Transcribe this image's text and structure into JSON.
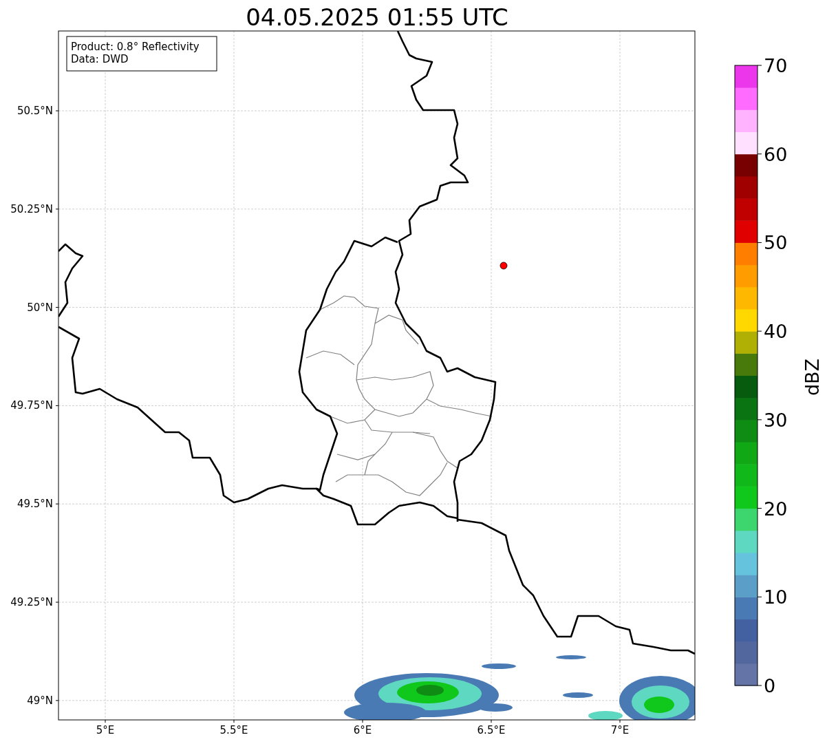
{
  "title": "04.05.2025 01:55 UTC",
  "info_box": [
    "Product: 0.8° Reflectivity",
    "Data: DWD"
  ],
  "y_ticks": [
    "50.5°N",
    "50.25°N",
    "50°N",
    "49.75°N",
    "49.5°N",
    "49.25°N",
    "49°N"
  ],
  "x_ticks": [
    "5°E",
    "5.5°E",
    "6°E",
    "6.5°E",
    "7°E"
  ],
  "colorbar": {
    "label": "dBZ",
    "ticks": [
      "70",
      "60",
      "50",
      "40",
      "30",
      "20",
      "10",
      "0"
    ],
    "bands": [
      {
        "color": "#6574a6"
      },
      {
        "color": "#53679f"
      },
      {
        "color": "#4360a0"
      },
      {
        "color": "#4a7ab3"
      },
      {
        "color": "#5b9fc8"
      },
      {
        "color": "#65c3de"
      },
      {
        "color": "#5fd8c2"
      },
      {
        "color": "#3dd66e"
      },
      {
        "color": "#10c81b"
      },
      {
        "color": "#10b81a"
      },
      {
        "color": "#10a815"
      },
      {
        "color": "#0e8c14"
      },
      {
        "color": "#0b7412"
      },
      {
        "color": "#075b0e"
      },
      {
        "color": "#477a0b"
      },
      {
        "color": "#b0b004"
      },
      {
        "color": "#ffd800"
      },
      {
        "color": "#ffb800"
      },
      {
        "color": "#ff9c00"
      },
      {
        "color": "#ff7e00"
      },
      {
        "color": "#e00000"
      },
      {
        "color": "#c00000"
      },
      {
        "color": "#a00000"
      },
      {
        "color": "#780000"
      },
      {
        "color": "#ffe0ff"
      },
      {
        "color": "#ffb3ff"
      },
      {
        "color": "#ff6bff"
      },
      {
        "color": "#ec36ec"
      }
    ]
  }
}
